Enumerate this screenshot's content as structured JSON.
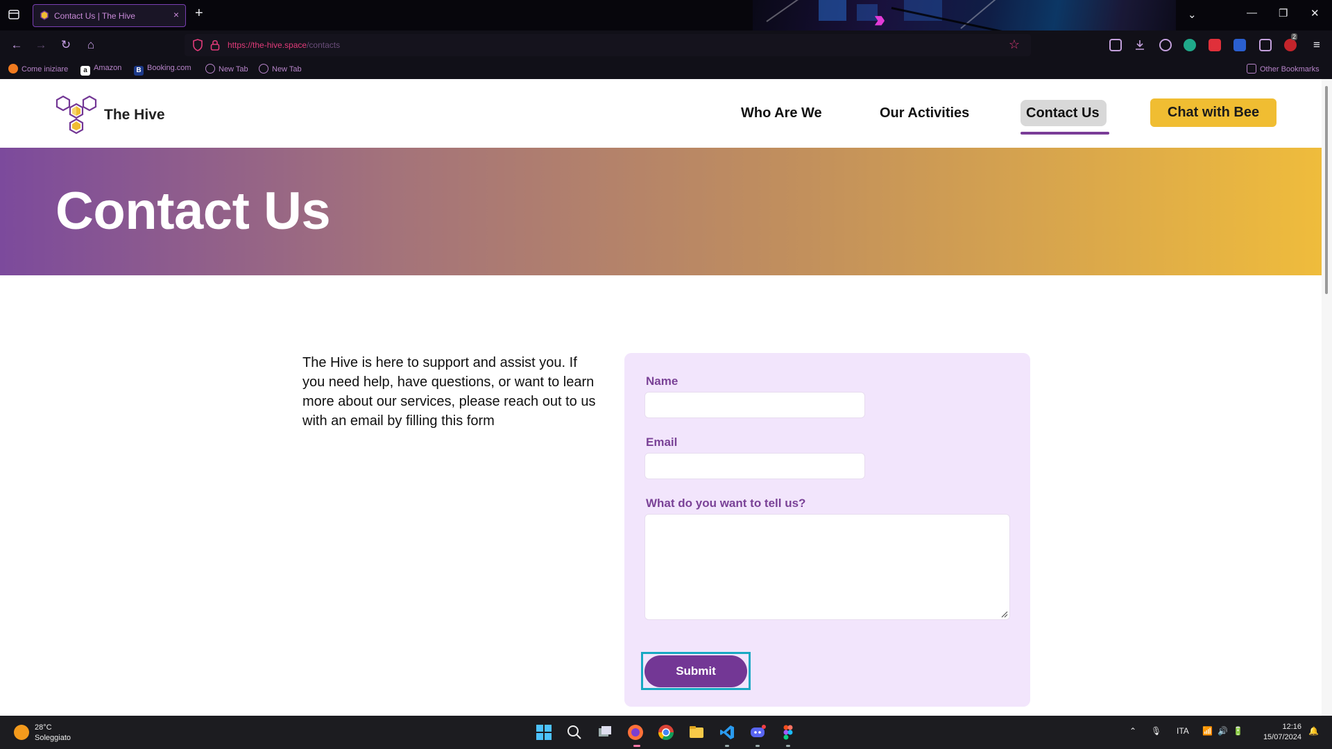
{
  "browser": {
    "tab_title": "Contact Us | The Hive",
    "tab_close": "×",
    "new_tab": "+",
    "url_host": "https://the-hive.space",
    "url_path": "/contacts",
    "bookmarks": [
      "Come iniziare",
      "Amazon",
      "Booking.com",
      "New Tab",
      "New Tab"
    ],
    "other_bookmarks": "Other Bookmarks",
    "extension_badge": "2",
    "window_controls": {
      "minimize": "—",
      "restore": "❐",
      "close": "✕"
    }
  },
  "site": {
    "brand": "The Hive",
    "nav": [
      "Who Are We",
      "Our Activities",
      "Contact Us"
    ],
    "active_nav": "Contact Us",
    "cta": "Chat with Bee",
    "hero_title": "Contact Us",
    "intro_text": "The Hive is here to support and assist you. If you need help, have questions, or want to learn more about our services, please reach out to us with an email by filling this form",
    "form": {
      "name_label": "Name",
      "email_label": "Email",
      "message_label": "What do you want to tell us?",
      "submit_label": "Submit"
    }
  },
  "colors": {
    "brand_purple": "#733795",
    "accent_yellow": "#f0bd32",
    "form_background": "#f2e5fc",
    "focus_ring": "#18a9c2"
  },
  "taskbar": {
    "temperature": "28°C",
    "weather": "Soleggiato",
    "language": "ITA",
    "time": "12:16",
    "date": "15/07/2024",
    "apps": [
      "start-icon",
      "search-icon",
      "task-view-icon",
      "firefox-icon",
      "chrome-icon",
      "file-explorer-icon",
      "vscode-icon",
      "discord-icon",
      "figma-icon"
    ]
  }
}
